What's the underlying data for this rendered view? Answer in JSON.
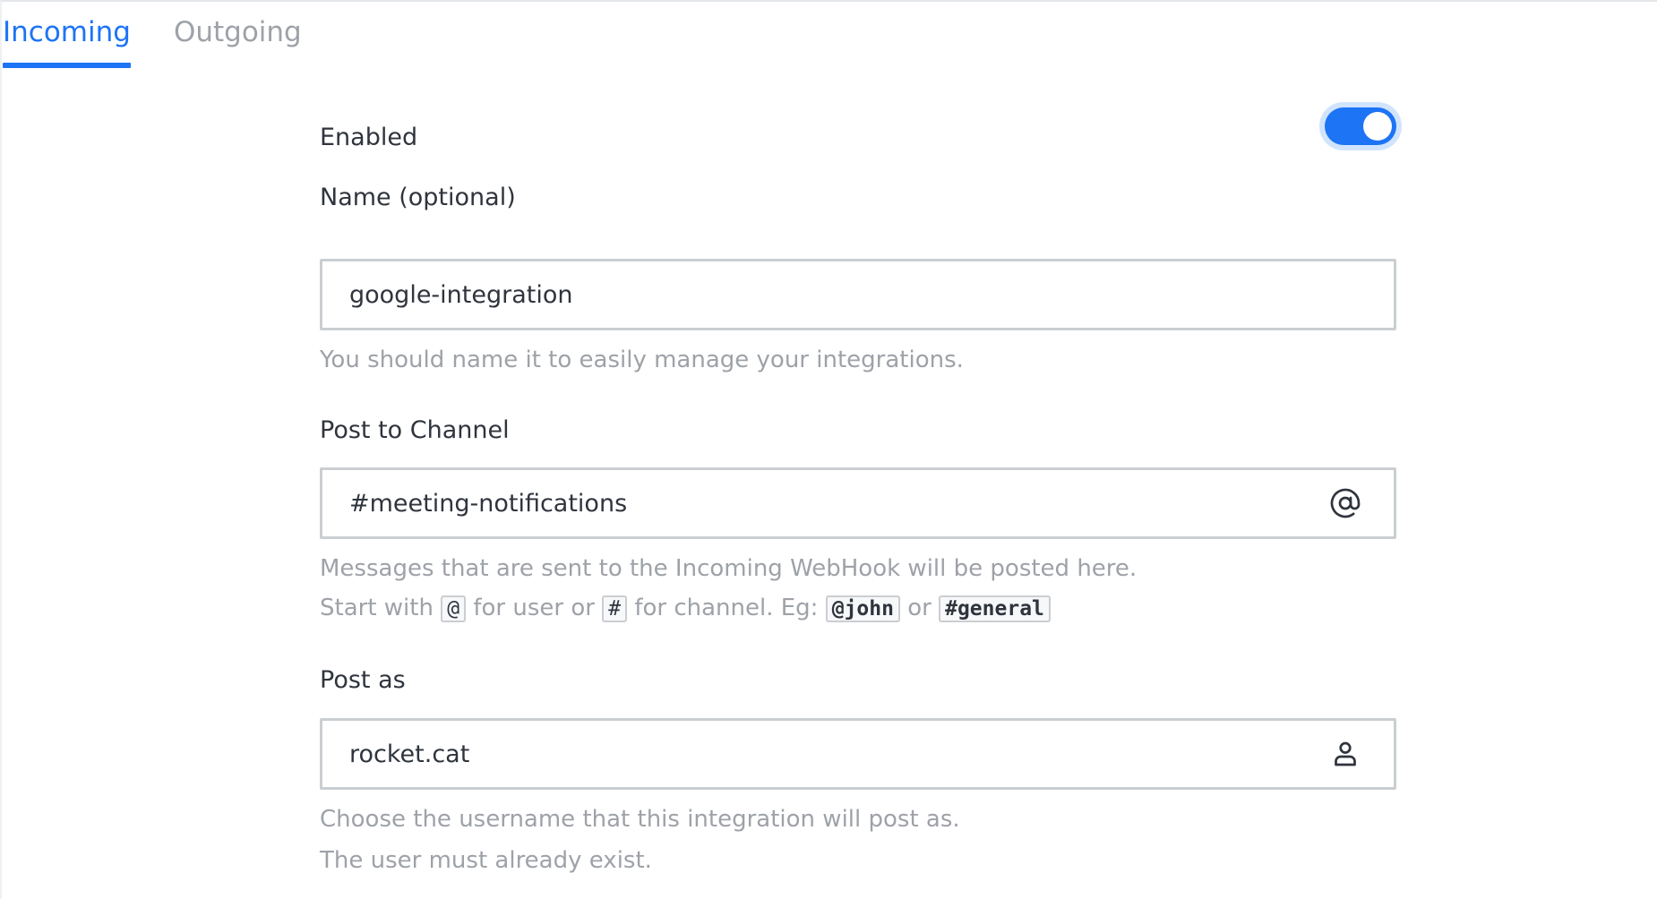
{
  "tabs": [
    {
      "label": "Incoming",
      "active": true
    },
    {
      "label": "Outgoing",
      "active": false
    }
  ],
  "form": {
    "enabled": {
      "label": "Enabled",
      "value": true
    },
    "name": {
      "label": "Name (optional)",
      "value": "google-integration",
      "hint": "You should name it to easily manage your integrations."
    },
    "channel": {
      "label": "Post to Channel",
      "value": "#meeting-notifications",
      "icon": "at-icon",
      "hint": "Messages that are sent to the Incoming WebHook will be posted here.",
      "hint2": {
        "start_with": "Start with",
        "user_symbol": "@",
        "for_user_or": "for user or",
        "channel_symbol": "#",
        "for_channel_eg": "for channel. Eg:",
        "example_user": "@john",
        "or": "or",
        "example_channel": "#general"
      }
    },
    "post_as": {
      "label": "Post as",
      "value": "rocket.cat",
      "icon": "user-icon",
      "hint": "Choose the username that this integration will post as.",
      "hint2": "The user must already exist."
    }
  },
  "colors": {
    "accent": "#1d74f5",
    "muted": "#9ea2a8",
    "text": "#2f343d",
    "border": "#cbced1"
  }
}
